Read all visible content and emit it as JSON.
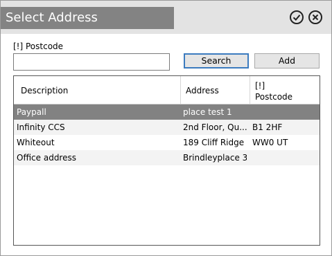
{
  "window": {
    "title": "Select Address",
    "ok_icon": "check-circle-icon",
    "close_icon": "x-circle-icon"
  },
  "form": {
    "postcode_label": "[!] Postcode",
    "postcode_value": "",
    "search_label": "Search",
    "add_label": "Add"
  },
  "grid": {
    "columns": {
      "description": "Description",
      "address": "Address",
      "postcode_line1": "[!]",
      "postcode_line2": "Postcode"
    },
    "rows": [
      {
        "description": "Paypall",
        "address": "place test 1",
        "postcode": ""
      },
      {
        "description": "Infinity CCS",
        "address": "2nd Floor, Qu...",
        "postcode": "B1 2HF"
      },
      {
        "description": "Whiteout",
        "address": "189 Cliff Ridge",
        "postcode": "WW0 UT"
      },
      {
        "description": "Office address",
        "address": "Brindleyplace 3",
        "postcode": ""
      }
    ],
    "selected_row": 0
  },
  "colors": {
    "title_block": "#838383",
    "titlebar": "#e3e3e3",
    "selected_row": "#828282",
    "search_border": "#3b7bbf"
  }
}
